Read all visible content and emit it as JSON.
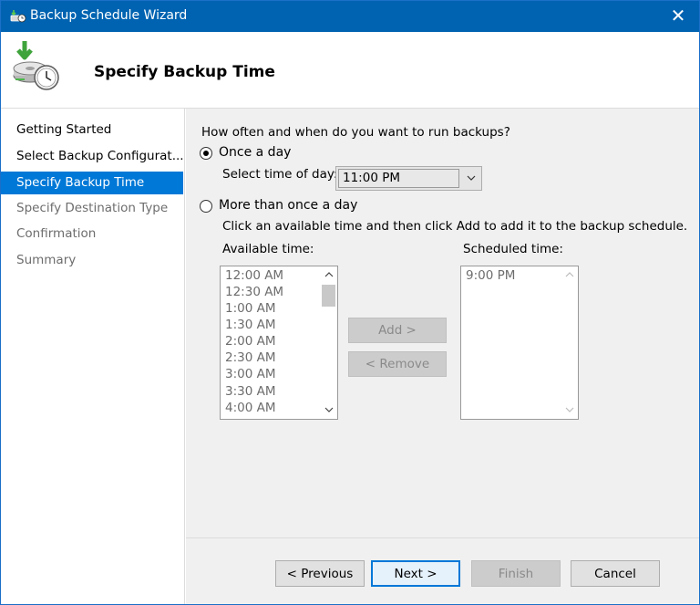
{
  "window": {
    "title": "Backup Schedule Wizard",
    "close_glyph": "✕"
  },
  "header": {
    "title": "Specify Backup Time"
  },
  "nav": {
    "items": [
      {
        "label": "Getting Started",
        "state": "done"
      },
      {
        "label": "Select Backup Configurat...",
        "state": "done"
      },
      {
        "label": "Specify Backup Time",
        "state": "selected"
      },
      {
        "label": "Specify Destination Type",
        "state": "pending"
      },
      {
        "label": "Confirmation",
        "state": "pending"
      },
      {
        "label": "Summary",
        "state": "pending"
      }
    ]
  },
  "content": {
    "question": "How often and when do you want to run backups?",
    "once_label": "Once a day",
    "once_checked": true,
    "select_time_label": "Select time of day:",
    "selected_time": "11:00 PM",
    "more_label": "More than once a day",
    "more_checked": false,
    "instruction": "Click an available time and then click Add to add it to the backup schedule.",
    "available_label": "Available time:",
    "available_times": [
      "12:00 AM",
      "12:30 AM",
      "1:00 AM",
      "1:30 AM",
      "2:00 AM",
      "2:30 AM",
      "3:00 AM",
      "3:30 AM",
      "4:00 AM"
    ],
    "scheduled_label": "Scheduled time:",
    "scheduled_times": [
      "9:00 PM"
    ],
    "add_label": "Add >",
    "remove_label": "< Remove"
  },
  "footer": {
    "previous_label": "< Previous",
    "next_label": "Next >",
    "finish_label": "Finish",
    "cancel_label": "Cancel"
  },
  "colors": {
    "titlebar": "#0063b1",
    "selected_nav": "#0078d7",
    "content_bg": "#f0f0f0"
  }
}
